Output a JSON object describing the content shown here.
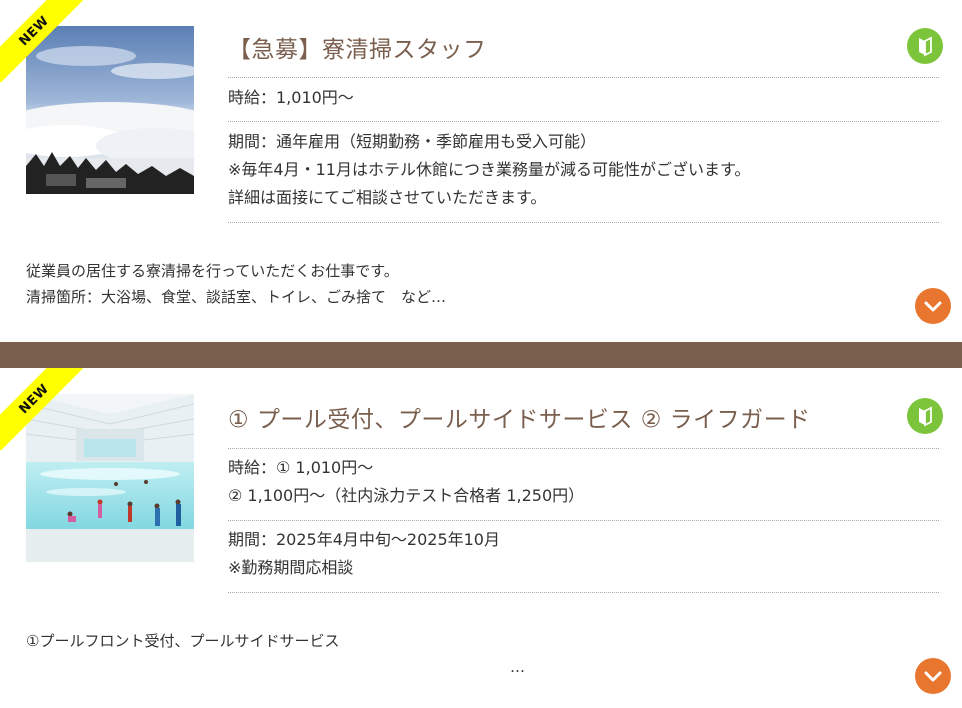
{
  "jobs": [
    {
      "ribbon": "NEW",
      "title": "【急募】寮清掃スタッフ",
      "photo": "sea-of-clouds-photo",
      "badge_icon": "beginner-mark-icon",
      "wage_lines": [
        "時給：1,010円～"
      ],
      "period_lines": [
        "期間：通年雇用（短期勤務・季節雇用も受入可能）",
        "※毎年4月・11月はホテル休館につき業務量が減る可能性がございます。",
        "詳細は面接にてご相談させていただきます。"
      ],
      "description_lines": [
        "従業員の居住する寮清掃を行っていただくお仕事です。",
        "清掃箇所：大浴場、食堂、談話室、トイレ、ごみ捨て　など…"
      ],
      "expand_icon": "chevron-down-icon"
    },
    {
      "ribbon": "NEW",
      "title": "① プール受付、プールサイドサービス ② ライフガード",
      "photo": "indoor-wave-pool-photo",
      "badge_icon": "beginner-mark-icon",
      "wage_lines": [
        "時給：① 1,010円～",
        "② 1,100円～（社内泳力テスト合格者 1,250円）"
      ],
      "period_lines": [
        "期間：2025年4月中旬～2025年10月",
        "※勤務期間応相談"
      ],
      "description_lines": [
        "①プールフロント受付、プールサイドサービス"
      ],
      "description_more": "…",
      "expand_icon": "chevron-down-icon"
    }
  ],
  "colors": {
    "separator": "#7a5f4e",
    "title": "#7a5f4e",
    "ribbon": "#ffff00",
    "badge": "#7cc43a",
    "expand_button": "#e8762e"
  }
}
